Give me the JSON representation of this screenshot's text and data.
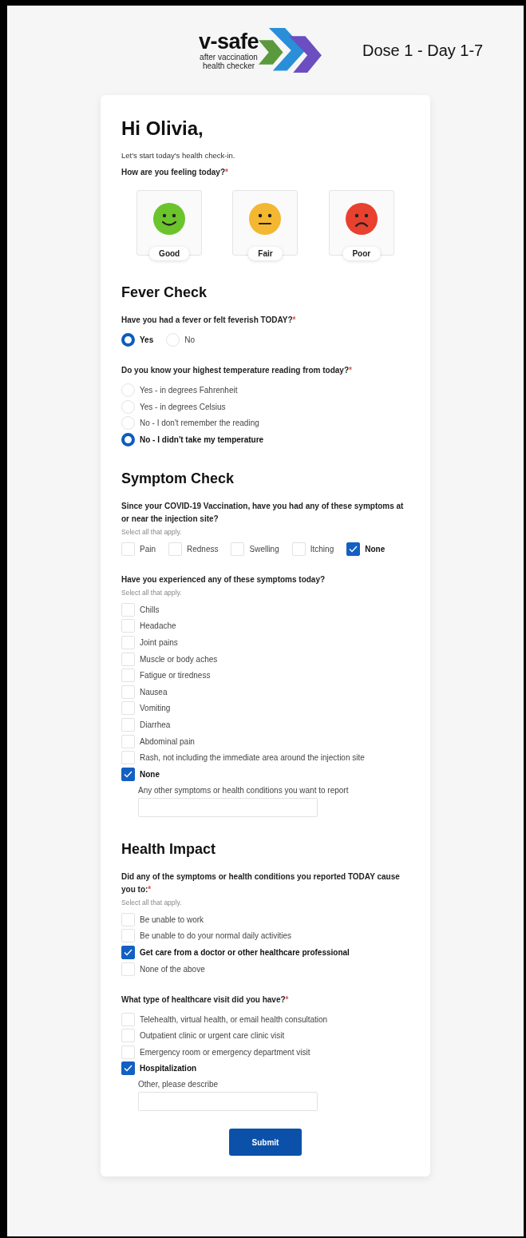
{
  "header": {
    "logo_name": "v-safe",
    "logo_tagline": [
      "after vaccination",
      "health checker"
    ],
    "dose_label": "Dose 1 - Day 1-7"
  },
  "greeting": "Hi Olivia,",
  "intro": "Let's start today's health check-in.",
  "mood": {
    "question": "How are you feeling today?",
    "required_mark": "*",
    "options": [
      {
        "label": "Good",
        "kind": "smile",
        "color": "#6cc42c"
      },
      {
        "label": "Fair",
        "kind": "neutral",
        "color": "#f4b731"
      },
      {
        "label": "Poor",
        "kind": "frown",
        "color": "#e8412f"
      }
    ]
  },
  "sections": [
    {
      "title": "Fever Check",
      "questions": [
        {
          "kind": "radio-row",
          "text": "Have you had a fever or felt feverish TODAY?",
          "required_mark": "*",
          "options": [
            {
              "label": "Yes",
              "selected": true
            },
            {
              "label": "No",
              "selected": false
            }
          ]
        },
        {
          "kind": "radio-list",
          "text": "Do you know your highest temperature reading from today?",
          "required_mark": "*",
          "options": [
            {
              "label": "Yes - in degrees Fahrenheit",
              "selected": false
            },
            {
              "label": "Yes - in degrees Celsius",
              "selected": false
            },
            {
              "label": "No - I don't remember the reading",
              "selected": false
            },
            {
              "label": "No - I didn't take my temperature",
              "selected": true
            }
          ]
        }
      ]
    },
    {
      "title": "Symptom Check",
      "questions": [
        {
          "kind": "checkbox-row",
          "text": "Since your COVID-19 Vaccination, have you had any of these symptoms at or near the injection site?",
          "hint": "Select all that apply.",
          "options": [
            {
              "label": "Pain",
              "checked": false
            },
            {
              "label": "Redness",
              "checked": false
            },
            {
              "label": "Swelling",
              "checked": false
            },
            {
              "label": "Itching",
              "checked": false
            },
            {
              "label": "None",
              "checked": true
            }
          ]
        },
        {
          "kind": "checkbox-list",
          "text": "Have you experienced any of these symptoms today?",
          "hint": "Select all that apply.",
          "options": [
            {
              "label": "Chills",
              "checked": false
            },
            {
              "label": "Headache",
              "checked": false
            },
            {
              "label": "Joint pains",
              "checked": false
            },
            {
              "label": "Muscle or body aches",
              "checked": false
            },
            {
              "label": "Fatigue or tiredness",
              "checked": false
            },
            {
              "label": "Nausea",
              "checked": false
            },
            {
              "label": "Vomiting",
              "checked": false
            },
            {
              "label": "Diarrhea",
              "checked": false
            },
            {
              "label": "Abdominal pain",
              "checked": false
            },
            {
              "label": "Rash, not including the immediate area around the injection site",
              "checked": false
            },
            {
              "label": "None",
              "checked": true
            }
          ],
          "followup": {
            "label": "Any other symptoms or health conditions you want to report"
          }
        }
      ]
    },
    {
      "title": "Health Impact",
      "questions": [
        {
          "kind": "checkbox-list",
          "text": "Did any of the symptoms or health conditions you reported TODAY cause you to:",
          "required_mark": "*",
          "hint": "Select all that apply.",
          "options": [
            {
              "label": "Be unable to work",
              "checked": false
            },
            {
              "label": "Be unable to do your normal daily activities",
              "checked": false
            },
            {
              "label": "Get care from a doctor or other healthcare professional",
              "checked": true
            },
            {
              "label": "None of the above",
              "checked": false
            }
          ]
        },
        {
          "kind": "checkbox-list",
          "text": "What type of healthcare visit did you have?",
          "required_mark": "*",
          "options": [
            {
              "label": "Telehealth, virtual health, or email health consultation",
              "checked": false
            },
            {
              "label": "Outpatient clinic or urgent care clinic visit",
              "checked": false
            },
            {
              "label": "Emergency room or emergency department visit",
              "checked": false
            },
            {
              "label": "Hospitalization",
              "checked": true
            }
          ],
          "followup": {
            "label": "Other, please describe"
          }
        }
      ]
    }
  ],
  "submit": "Submit"
}
